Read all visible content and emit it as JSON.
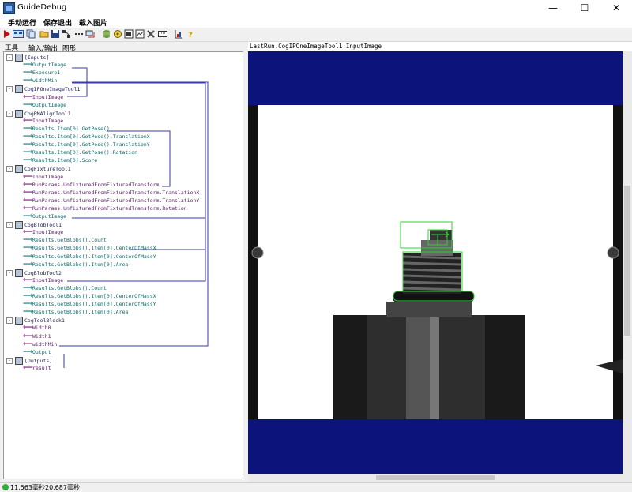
{
  "window": {
    "title": "GuideDebug",
    "minimize": "—",
    "maximize": "☐",
    "close": "✕"
  },
  "menu": {
    "items": [
      "手动运行",
      "保存退出",
      "载入图片"
    ]
  },
  "toolbar": {
    "icons": [
      "run-icon",
      "grid-icon",
      "copy-icon",
      "open-icon",
      "save-icon",
      "network-icon",
      "dots-icon",
      "link-icon",
      "database-icon",
      "settings-icon",
      "image-icon",
      "chart-icon",
      "tools-icon",
      "keyboard-icon",
      "ruler-icon",
      "help-icon"
    ]
  },
  "tabs": {
    "tools": "工具",
    "io": "输入/输出",
    "graphics": "图形"
  },
  "tree": [
    {
      "label": "[Inputs]",
      "kind": "node"
    },
    {
      "label": "OutputImage",
      "kind": "out"
    },
    {
      "label": "Exposure1",
      "kind": "out"
    },
    {
      "label": "widthMin",
      "kind": "out"
    },
    {
      "label": "CogIPOneImageTool1",
      "kind": "node"
    },
    {
      "label": "InputImage",
      "kind": "in"
    },
    {
      "label": "OutputImage",
      "kind": "out"
    },
    {
      "label": "CogPMAlignTool1",
      "kind": "node"
    },
    {
      "label": "InputImage",
      "kind": "in"
    },
    {
      "label": "Results.Item[0].GetPose()",
      "kind": "out"
    },
    {
      "label": "Results.Item[0].GetPose().TranslationX",
      "kind": "out"
    },
    {
      "label": "Results.Item[0].GetPose().TranslationY",
      "kind": "out"
    },
    {
      "label": "Results.Item[0].GetPose().Rotation",
      "kind": "out"
    },
    {
      "label": "Results.Item[0].Score",
      "kind": "out"
    },
    {
      "label": "CogFixtureTool1",
      "kind": "node"
    },
    {
      "label": "InputImage",
      "kind": "in"
    },
    {
      "label": "RunParams.UnfixturedFromFixturedTransform",
      "kind": "in"
    },
    {
      "label": "RunParams.UnfixturedFromFixturedTransform.TranslationX",
      "kind": "in"
    },
    {
      "label": "RunParams.UnfixturedFromFixturedTransform.TranslationY",
      "kind": "in"
    },
    {
      "label": "RunParams.UnfixturedFromFixturedTransform.Rotation",
      "kind": "in"
    },
    {
      "label": "OutputImage",
      "kind": "out"
    },
    {
      "label": "CogBlobTool1",
      "kind": "node"
    },
    {
      "label": "InputImage",
      "kind": "in"
    },
    {
      "label": "Results.GetBlobs().Count",
      "kind": "out"
    },
    {
      "label": "Results.GetBlobs().Item[0].CenterOfMassX",
      "kind": "out"
    },
    {
      "label": "Results.GetBlobs().Item[0].CenterOfMassY",
      "kind": "out"
    },
    {
      "label": "Results.GetBlobs().Item[0].Area",
      "kind": "out"
    },
    {
      "label": "CogBlobTool2",
      "kind": "node"
    },
    {
      "label": "InputImage",
      "kind": "in"
    },
    {
      "label": "Results.GetBlobs().Count",
      "kind": "out"
    },
    {
      "label": "Results.GetBlobs().Item[0].CenterOfMassX",
      "kind": "out"
    },
    {
      "label": "Results.GetBlobs().Item[0].CenterOfMassY",
      "kind": "out"
    },
    {
      "label": "Results.GetBlobs().Item[0].Area",
      "kind": "out"
    },
    {
      "label": "CogToolBlock1",
      "kind": "node"
    },
    {
      "label": "Width0",
      "kind": "in"
    },
    {
      "label": "Width1",
      "kind": "in"
    },
    {
      "label": "widthMin",
      "kind": "in"
    },
    {
      "label": "Output",
      "kind": "out"
    },
    {
      "label": "[Outputs]",
      "kind": "node"
    },
    {
      "label": "result",
      "kind": "in"
    }
  ],
  "display": {
    "title": "LastRun.CogIPOneImageTool1.InputImage"
  },
  "status": {
    "text": "11.563毫秒20.687毫秒"
  }
}
